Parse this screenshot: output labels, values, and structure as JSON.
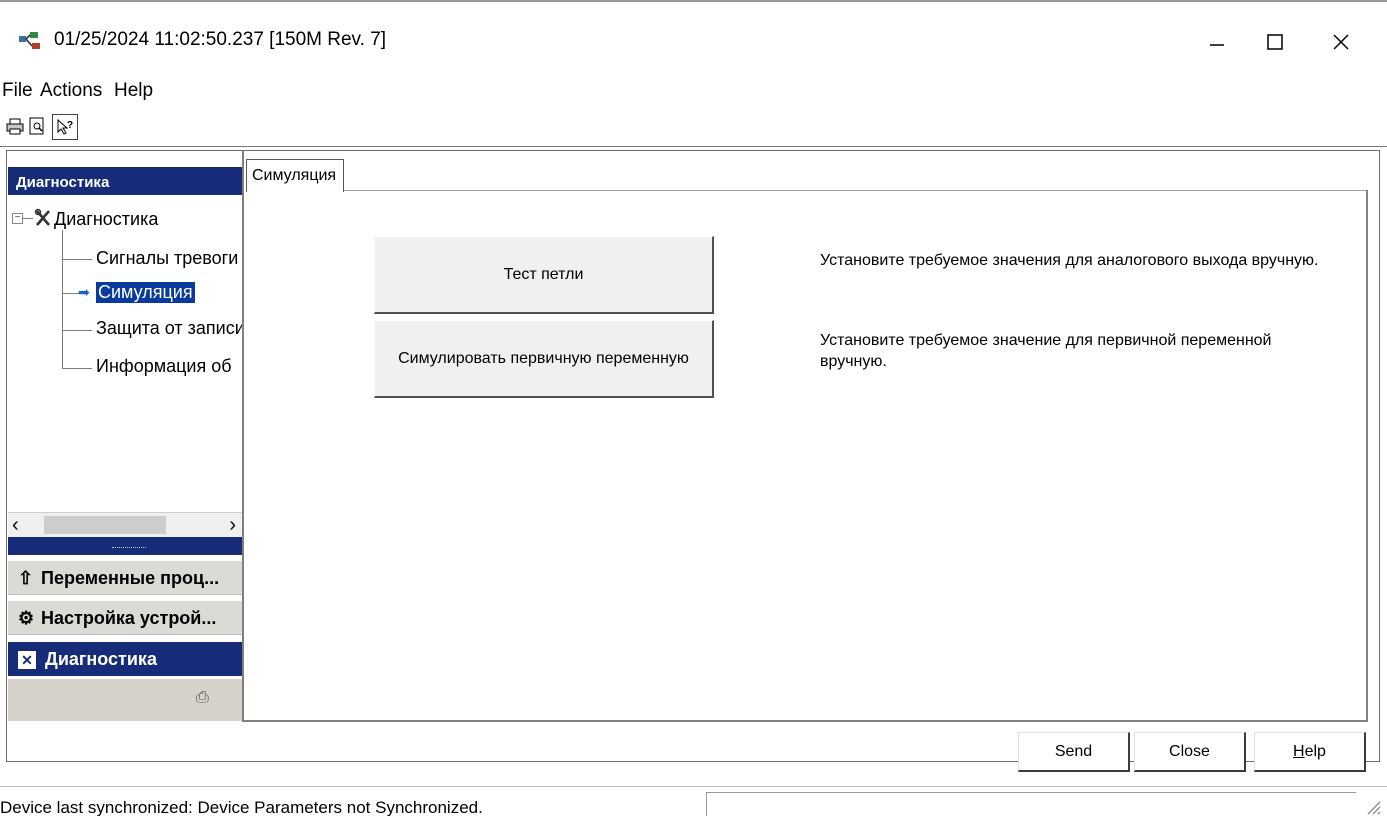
{
  "window": {
    "title": "01/25/2024 11:02:50.237 [150M Rev. 7]",
    "icons": {
      "app": "device-network-icon",
      "minimize": "minimize-icon",
      "maximize": "maximize-icon",
      "close": "close-icon"
    }
  },
  "menu": {
    "items": [
      "File",
      "Actions",
      "Help"
    ]
  },
  "toolbar": {
    "icons": [
      "print-icon",
      "print-preview-icon",
      "context-help-icon"
    ]
  },
  "left_panel": {
    "header": "Диагностика",
    "tree": {
      "root": "Диагностика",
      "children": [
        {
          "label": "Сигналы тревоги",
          "selected": false
        },
        {
          "label": "Симуляция",
          "selected": true
        },
        {
          "label": "Защита от записи",
          "selected": false
        },
        {
          "label": "Информация об",
          "selected": false
        }
      ]
    },
    "nav_tabs": [
      {
        "label": "Переменные проц...",
        "icon": "process-variables-icon",
        "active": false
      },
      {
        "label": "Настройка устрой...",
        "icon": "device-setup-icon",
        "active": false
      },
      {
        "label": "Диагностика",
        "icon": "diagnostics-icon",
        "active": true
      }
    ]
  },
  "main": {
    "tab": "Симуляция",
    "actions": [
      {
        "label": "Тест петли",
        "description": "Установите требуемое значения для аналогового выхода вручную."
      },
      {
        "label": "Симулировать первичную переменную",
        "description": "Установите требуемое значение для первичной переменной вручную."
      }
    ]
  },
  "buttons": {
    "send": "Send",
    "close": "Close",
    "help_mnemonic": "H",
    "help_rest": "elp"
  },
  "status": {
    "text": "Device last synchronized: Device Parameters not Synchronized."
  },
  "colors": {
    "nav_dark": "#162c78",
    "nav_light": "#dcdad4",
    "selection": "#0a3a9e"
  }
}
